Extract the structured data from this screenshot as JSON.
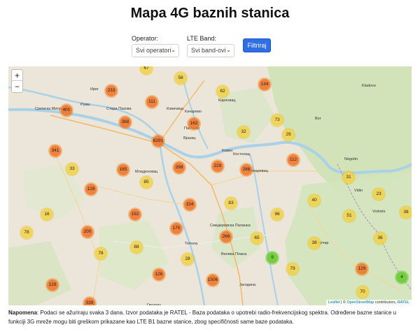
{
  "page": {
    "title": "Mapa 4G baznih stanica"
  },
  "filters": {
    "operator_label": "Operator:",
    "operator_value": "Svi operatori",
    "band_label": "LTE Band:",
    "band_value": "Svi band-ovi",
    "submit_label": "Filtriraj"
  },
  "map": {
    "zoom_in": "+",
    "zoom_out": "−",
    "attribution_leaflet": "Leaflet",
    "attribution_sep": " | © ",
    "attribution_osm": "OpenStreetMap",
    "attribution_mid": " contributors, ",
    "attribution_ratel": "RATEL",
    "places": [
      "Ирег",
      "Рума",
      "Сремска Митровица",
      "Стара Пазова",
      "Ковачица",
      "Карловац",
      "Качарево",
      "Вршац",
      "Панчево",
      "Ковин",
      "Костолац",
      "Пожаревац",
      "Младеновац",
      "Смедеревска Паланка",
      "Топола",
      "Велика Плана",
      "Јагодина",
      "Гвоздац",
      "Bor",
      "Kladovo",
      "Negotin",
      "Зајечар",
      "Vidin",
      "Vrshets"
    ],
    "clusters": [
      {
        "count": "67",
        "color": "yellow"
      },
      {
        "count": "58",
        "color": "yellow"
      },
      {
        "count": "233",
        "color": "orange"
      },
      {
        "count": "134",
        "color": "orange"
      },
      {
        "count": "82",
        "color": "yellow"
      },
      {
        "count": "111",
        "color": "orange"
      },
      {
        "count": "401",
        "color": "orange"
      },
      {
        "count": "388",
        "color": "orange"
      },
      {
        "count": "73",
        "color": "yellow"
      },
      {
        "count": "162",
        "color": "orange"
      },
      {
        "count": "32",
        "color": "yellow"
      },
      {
        "count": "29",
        "color": "yellow"
      },
      {
        "count": "6291",
        "color": "orange"
      },
      {
        "count": "341",
        "color": "orange"
      },
      {
        "count": "112",
        "color": "orange"
      },
      {
        "count": "33",
        "color": "yellow"
      },
      {
        "count": "185",
        "color": "orange"
      },
      {
        "count": "298",
        "color": "orange"
      },
      {
        "count": "229",
        "color": "orange"
      },
      {
        "count": "286",
        "color": "orange"
      },
      {
        "count": "31",
        "color": "yellow"
      },
      {
        "count": "128",
        "color": "orange"
      },
      {
        "count": "85",
        "color": "yellow"
      },
      {
        "count": "23",
        "color": "yellow"
      },
      {
        "count": "154",
        "color": "orange"
      },
      {
        "count": "83",
        "color": "yellow"
      },
      {
        "count": "40",
        "color": "yellow"
      },
      {
        "count": "16",
        "color": "yellow"
      },
      {
        "count": "192",
        "color": "orange"
      },
      {
        "count": "96",
        "color": "yellow"
      },
      {
        "count": "51",
        "color": "yellow"
      },
      {
        "count": "38",
        "color": "yellow"
      },
      {
        "count": "78",
        "color": "yellow"
      },
      {
        "count": "200",
        "color": "orange"
      },
      {
        "count": "175",
        "color": "orange"
      },
      {
        "count": "266",
        "color": "orange"
      },
      {
        "count": "65",
        "color": "yellow"
      },
      {
        "count": "36",
        "color": "yellow"
      },
      {
        "count": "38",
        "color": "yellow"
      },
      {
        "count": "78",
        "color": "yellow"
      },
      {
        "count": "88",
        "color": "yellow"
      },
      {
        "count": "28",
        "color": "yellow"
      },
      {
        "count": "9",
        "color": "green"
      },
      {
        "count": "79",
        "color": "yellow"
      },
      {
        "count": "129",
        "color": "orange"
      },
      {
        "count": "126",
        "color": "orange"
      },
      {
        "count": "1506",
        "color": "orange"
      },
      {
        "count": "4",
        "color": "green"
      },
      {
        "count": "129",
        "color": "orange"
      },
      {
        "count": "70",
        "color": "yellow"
      },
      {
        "count": "339",
        "color": "orange"
      }
    ]
  },
  "note": {
    "label": "Napomena",
    "text": ": Podaci se ažuriraju svaka 3 dana. Izvor podataka je RATEL - Baza podataka o upotrebi radio-frekvencijskog spektra. Određene bazne stanice u funkciji 3G mreže mogu biti greškom prikazane kao LTE B1 bazne stanice, zbog specifičnosti same baze podataka."
  },
  "colors": {
    "accent": "#2f6ee6",
    "cluster_orange": "#f07028",
    "cluster_yellow": "#f1d357",
    "cluster_green": "#6ecc39",
    "danube": "#a9d1e8"
  }
}
